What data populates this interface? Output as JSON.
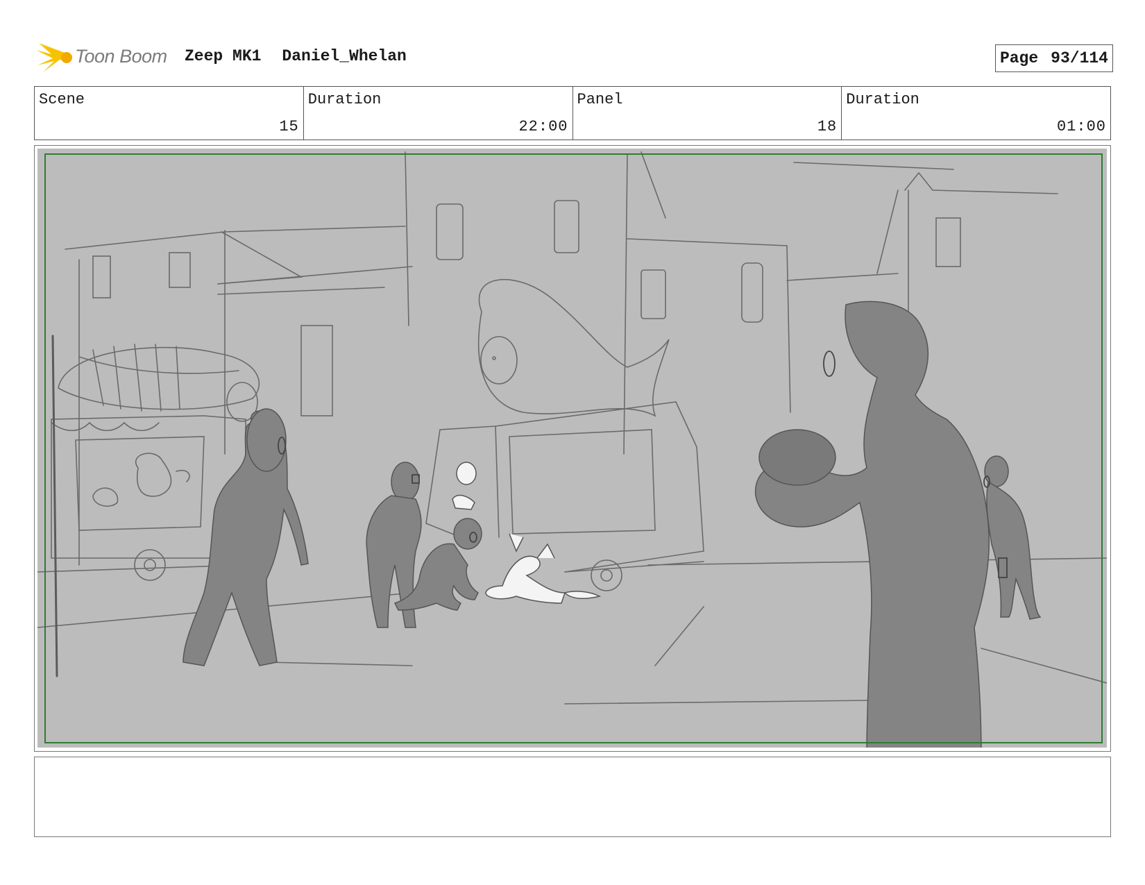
{
  "header": {
    "logo_text": "Toon Boom",
    "project": "Zeep MK1",
    "author": "Daniel_Whelan",
    "page_label": "Page",
    "page_number": "93/114"
  },
  "info": {
    "scene_label": "Scene",
    "scene_value": "15",
    "scene_duration_label": "Duration",
    "scene_duration_value": "22:00",
    "panel_label": "Panel",
    "panel_value": "18",
    "panel_duration_label": "Duration",
    "panel_duration_value": "01:00"
  },
  "colors": {
    "panel_background": "#bcbcbc",
    "safe_frame": "#2e7d32",
    "figure_fill": "#848484",
    "sketch_line": "#666666",
    "logo_yellow": "#f7c300"
  },
  "notes": ""
}
